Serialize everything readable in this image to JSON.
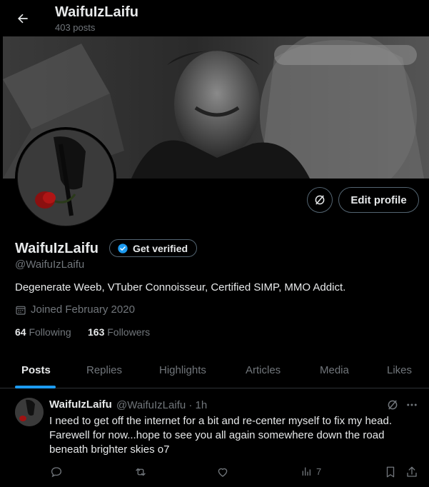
{
  "header": {
    "title": "WaifuIzLaifu",
    "posts_count": "403 posts"
  },
  "profile": {
    "display_name": "WaifuIzLaifu",
    "verify_label": "Get verified",
    "handle": "@WaifuIzLaifu",
    "bio": "Degenerate Weeb, VTuber Connoisseur, Certified SIMP, MMO Addict.",
    "joined": "Joined February 2020",
    "following_count": "64",
    "following_label": "Following",
    "followers_count": "163",
    "followers_label": "Followers",
    "edit_label": "Edit profile"
  },
  "tabs": [
    {
      "label": "Posts",
      "active": true
    },
    {
      "label": "Replies"
    },
    {
      "label": "Highlights"
    },
    {
      "label": "Articles"
    },
    {
      "label": "Media"
    },
    {
      "label": "Likes"
    }
  ],
  "post": {
    "author": "WaifuIzLaifu",
    "meta": "@WaifuIzLaifu · 1h",
    "text": "I need to get off the internet for a bit and re-center myself to fix my head. Farewell for now...hope to see you all again somewhere down the road beneath brighter skies o7",
    "views": "7"
  },
  "colors": {
    "background": "#000000",
    "text": "#e7e9ea",
    "muted": "#71767b",
    "border": "#2f3336",
    "accent": "#1d9bf0"
  },
  "icons": [
    "back-arrow-icon",
    "grok-icon",
    "verified-badge-icon",
    "calendar-icon",
    "reply-icon",
    "repost-icon",
    "like-icon",
    "views-icon",
    "bookmark-icon",
    "share-icon",
    "more-icon"
  ]
}
